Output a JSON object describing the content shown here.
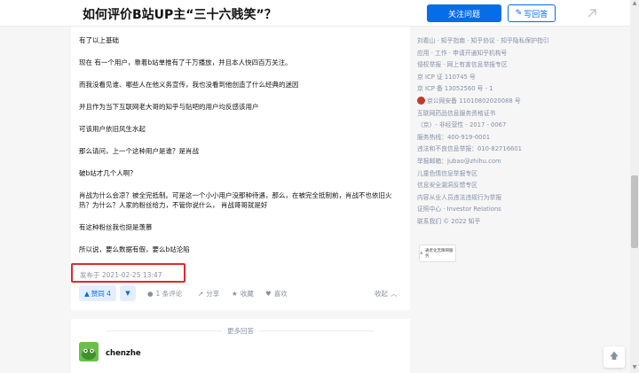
{
  "header": {
    "question_title": "如何评价B站UP主“三十六贱笑”？",
    "follow_label": "关注问题",
    "write_label": "写回答"
  },
  "answer": {
    "paragraphs": [
      "有了以上基础",
      "现在 有一个用户，靠着b站单推有了千万播放，并且本人快四百万关注。",
      "而我没看见谁、哪些人在他义务宣传，我也没看到他创造了什么经典的迷因",
      "并且作为当下互联网老大哥的知乎与贴吧的用户均反感该用户",
      "可该用户依旧风生水起",
      "那么请问，上一个这种用户是谁？是肖战",
      "破b站才几个人啊？",
      "肖战为什么会凉？被全完抵制。可是这一个小小用户没那种待遇，那么，在被完全抵制前，肖战不也依旧火热？为什么？人家的粉丝给力，不管你说什么， 肖战哥哥就是好",
      "有这种粉丝我也挺是羡慕",
      "所以说，要么数据有假，要么b站沦陷"
    ],
    "published": "发布于 2021-02-25 13:47"
  },
  "actions": {
    "vote_up": "赞同 4",
    "comments": "1 条评论",
    "share": "分享",
    "favorite": "收藏",
    "like": "喜欢",
    "collapse": "收起"
  },
  "more_answers": {
    "label": "更多回答",
    "author": "chenzhe"
  },
  "sidebar": {
    "lines": [
      "刘看山 · 知乎指南 · 知乎协议 · 知乎隐私保护指引",
      "应用 · 工作 · 申请开通知乎机构号",
      "侵权举报 · 网上有害信息举报专区",
      "京 ICP 证 110745 号",
      "京 ICP 备 13052560 号 - 1",
      "京公网安备 11010802020088 号",
      "互联网药品信息服务资格证书",
      "（京）- 非经营性 - 2017 - 0067",
      "服务热线：400-919-0001",
      "违法和不良信息举报：010-82716601",
      "举报邮箱：jubao@zhihu.com",
      "儿童色情信息举报专区",
      "信息安全漏洞反馈专区",
      "内容从业人员违法违规行为举报",
      "证照中心 · Investor Relations",
      "联系我们 © 2022 知乎"
    ],
    "badge_text": "通老化无障碍服务"
  },
  "colors": {
    "brand": "#056de8",
    "highlight": "#e0282e",
    "muted": "#8590a6"
  }
}
